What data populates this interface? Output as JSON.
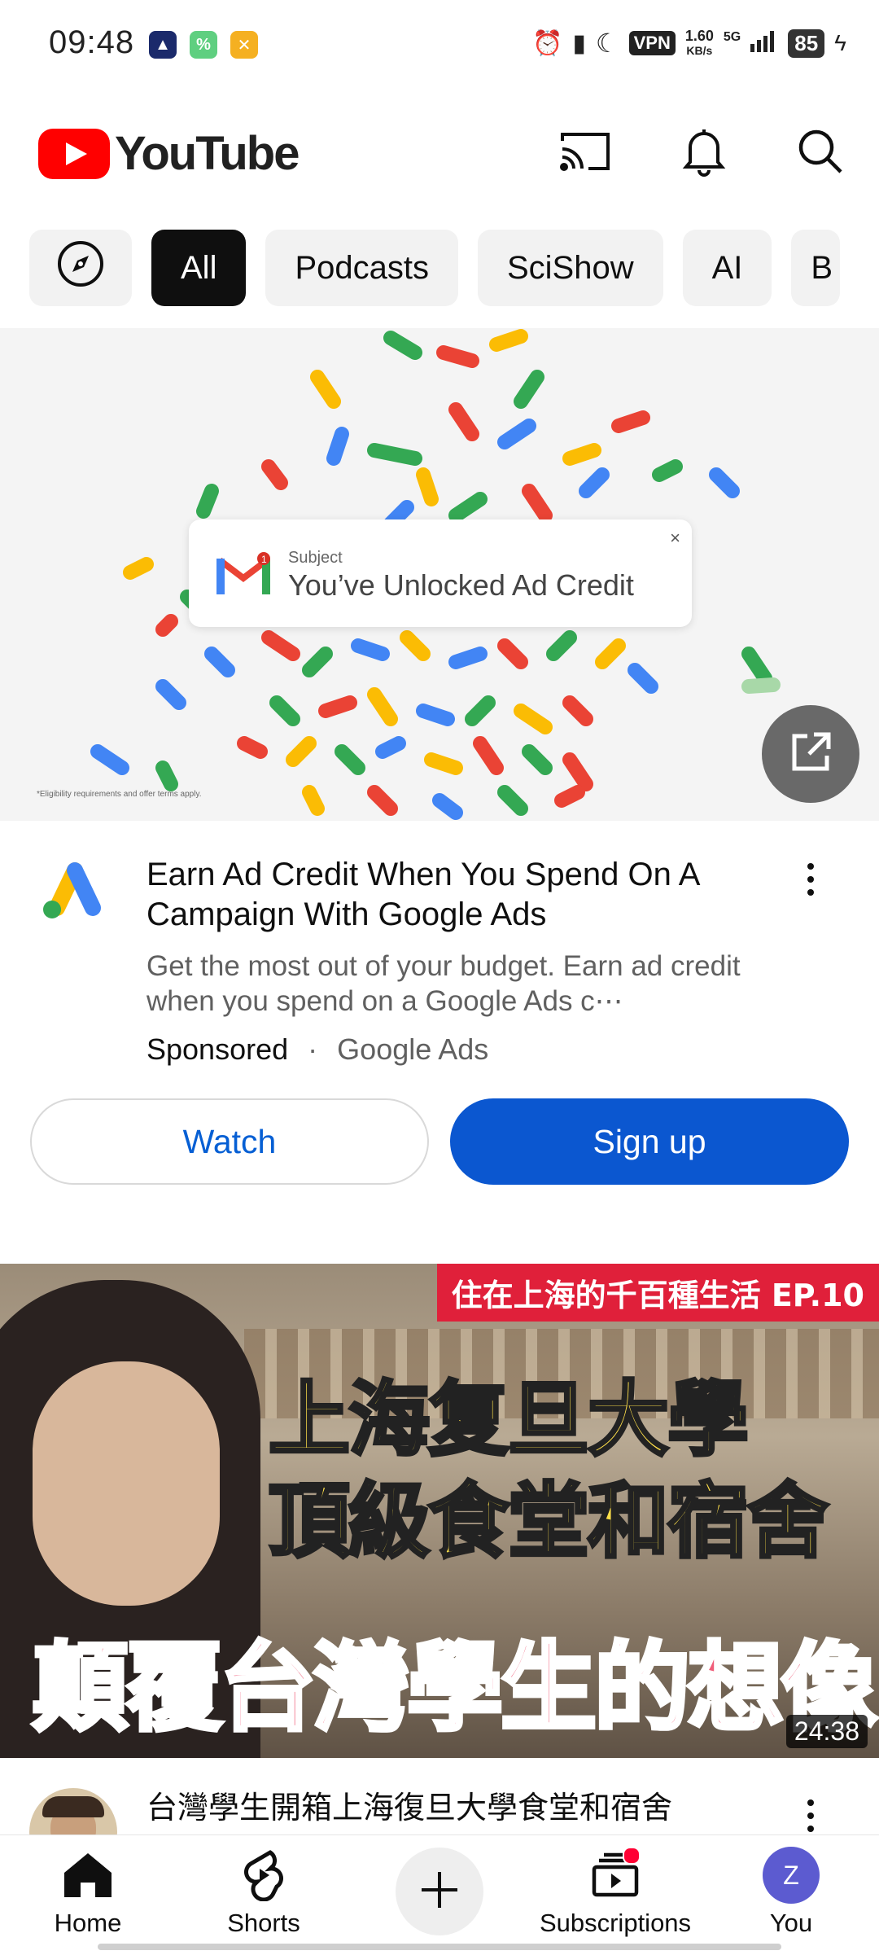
{
  "status_bar": {
    "time": "09:48",
    "vpn": "VPN",
    "net_speed_value": "1.60",
    "net_speed_unit": "KB/s",
    "network": "5G",
    "battery": "85"
  },
  "header": {
    "logo_text": "YouTube",
    "icons": [
      "cast-icon",
      "bell-icon",
      "search-icon"
    ]
  },
  "chips": [
    {
      "label": "All",
      "selected": true
    },
    {
      "label": "Podcasts",
      "selected": false
    },
    {
      "label": "SciShow",
      "selected": false
    },
    {
      "label": "AI",
      "selected": false
    },
    {
      "label": "B",
      "selected": false
    }
  ],
  "ad": {
    "card_subject": "Subject",
    "card_headline": "You’ve Unlocked Ad Credit",
    "card_close": "×",
    "fine_print": "*Eligibility requirements and offer terms apply.",
    "title": "Earn Ad Credit When You Spend On A Campaign With Google Ads",
    "description": "Get the most out of your budget. Earn ad credit when you spend on a Google Ads c⋯",
    "sponsored_label": "Sponsored",
    "separator": "·",
    "advertiser": "Google Ads",
    "watch_label": "Watch",
    "signup_label": "Sign up"
  },
  "video": {
    "badge": "住在上海的千百種生活 EP.10",
    "thumb_line1": "上海复旦大學",
    "thumb_line2": "頂級食堂和宿舍",
    "thumb_line3": "顛覆台灣學生的想像",
    "duration": "24:38",
    "title": "台灣學生開箱上海復旦大學食堂和宿舍"
  },
  "bottom_nav": {
    "home": "Home",
    "shorts": "Shorts",
    "subscriptions": "Subscriptions",
    "you": "You",
    "you_initial": "Z"
  },
  "colors": {
    "youtube_red": "#ff0000",
    "signup_blue": "#0b57d0",
    "watch_text_blue": "#065fd4"
  }
}
